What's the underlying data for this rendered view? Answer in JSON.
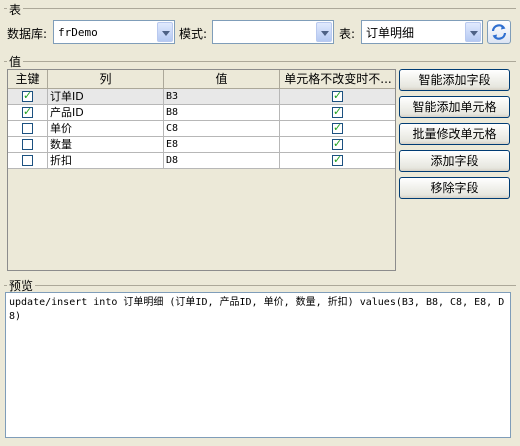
{
  "sections": {
    "table_section": "表",
    "values_section": "值",
    "preview_section": "预览"
  },
  "top": {
    "database_label": "数据库:",
    "database_value": "frDemo",
    "schema_label": "模式:",
    "schema_value": "",
    "table_label": "表:",
    "table_value": "订单明细",
    "refresh_icon": "refresh-icon"
  },
  "grid": {
    "headers": [
      "主键",
      "列",
      "值",
      "单元格不改变时不..."
    ],
    "rows": [
      {
        "key": true,
        "column": "订单ID",
        "value": "B3",
        "no_update": true,
        "selected": true
      },
      {
        "key": true,
        "column": "产品ID",
        "value": "B8",
        "no_update": true,
        "selected": false
      },
      {
        "key": false,
        "column": "单价",
        "value": "C8",
        "no_update": true,
        "selected": false
      },
      {
        "key": false,
        "column": "数量",
        "value": "E8",
        "no_update": true,
        "selected": false
      },
      {
        "key": false,
        "column": "折扣",
        "value": "D8",
        "no_update": true,
        "selected": false
      }
    ]
  },
  "buttons": {
    "smart_add_field": "智能添加字段",
    "smart_add_cell": "智能添加单元格",
    "batch_modify_cell": "批量修改单元格",
    "add_field": "添加字段",
    "remove_field": "移除字段"
  },
  "preview": {
    "text": "update/insert into 订单明细 (订单ID, 产品ID, 单价, 数量, 折扣) values(B3, B8, C8, E8, D8)"
  }
}
